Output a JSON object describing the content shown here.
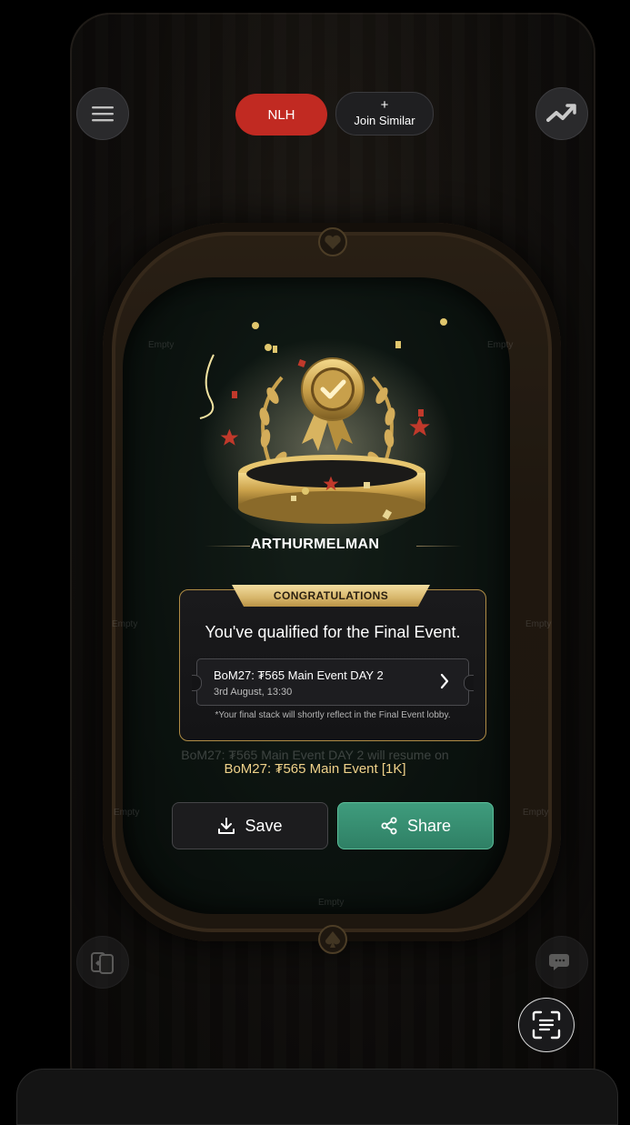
{
  "top_bar": {
    "menu_icon": "menu-icon",
    "game_tab": "NLH",
    "join_plus": "+",
    "join_label": "Join Similar",
    "stats_icon": "chart-icon"
  },
  "table": {
    "seat_label": "Empty"
  },
  "winner": {
    "player_name": "ARTHURMELMAN"
  },
  "card": {
    "ribbon": "CONGRATULATIONS",
    "headline": "You've qualified for the Final Event.",
    "event_title": "BoM27: ₮565 Main Event DAY 2",
    "event_date": "3rd August, 13:30",
    "note": "*Your final stack will shortly reflect in the Final Event lobby."
  },
  "background_text": {
    "resume": "BoM27: ₮565 Main Event DAY 2 will resume on"
  },
  "event_link": "BoM27: ₮565 Main Event [1K]",
  "actions": {
    "save_label": "Save",
    "share_label": "Share"
  },
  "colors": {
    "nlh_red": "#c12a22",
    "share_green": "#3a9476",
    "gold": "#d7b66b"
  }
}
